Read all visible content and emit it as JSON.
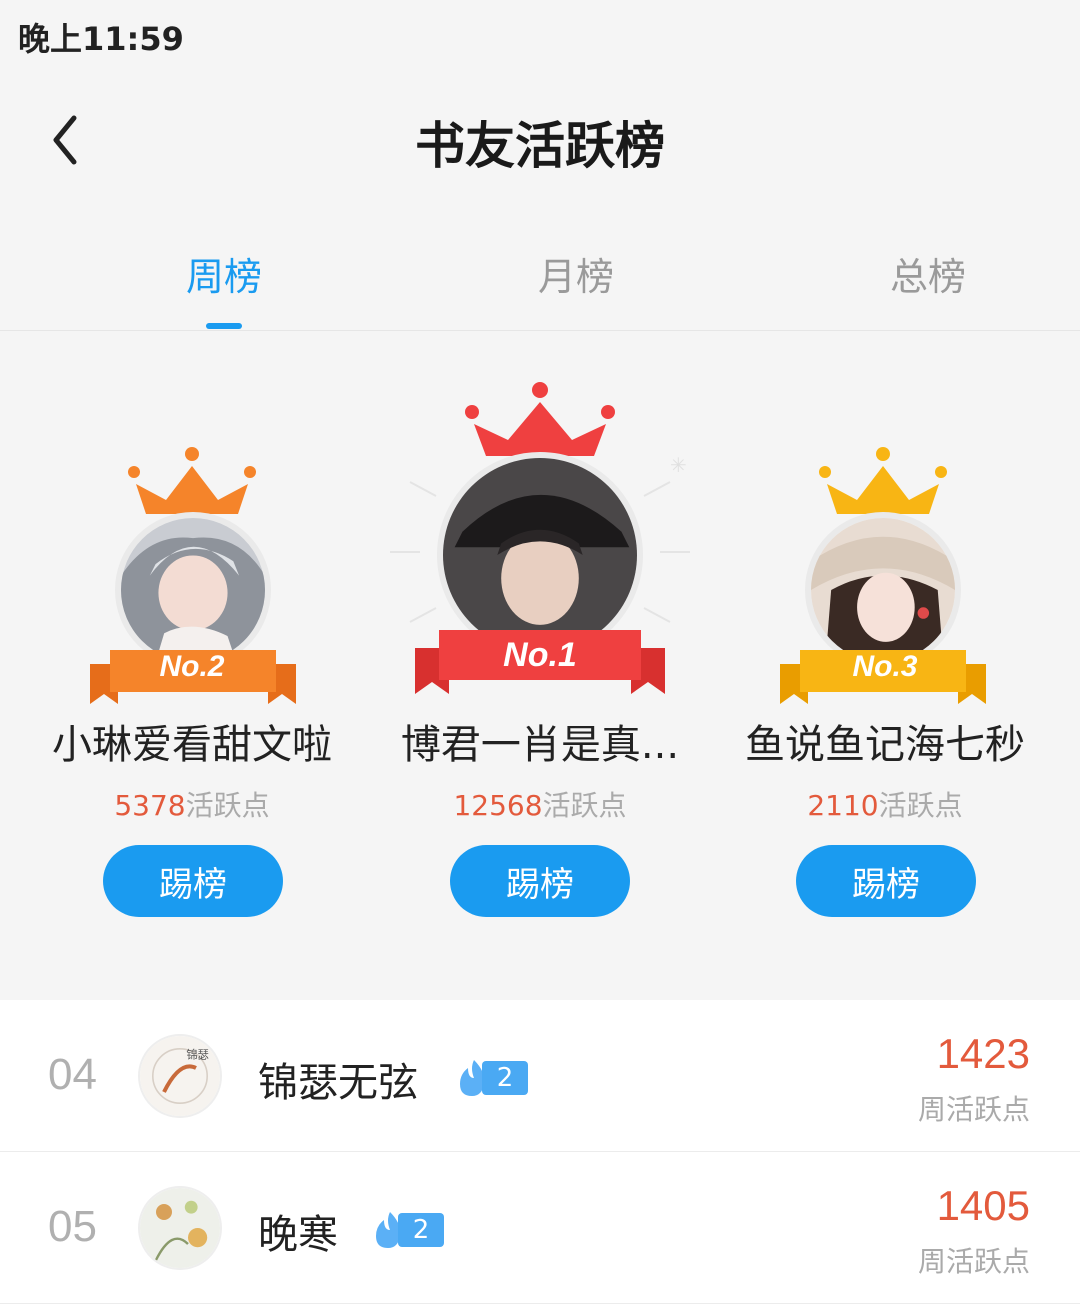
{
  "status_bar": {
    "time": "晚上11:59"
  },
  "header": {
    "title": "书友活跃榜"
  },
  "tabs": [
    {
      "label": "周榜",
      "active": true
    },
    {
      "label": "月榜",
      "active": false
    },
    {
      "label": "总榜",
      "active": false
    }
  ],
  "podium": [
    {
      "rank_label": "No.2",
      "name": "小琳爱看甜文啦",
      "points": "5378",
      "points_suffix": "活跃点",
      "button": "踢榜",
      "crown_color": "#f5842a"
    },
    {
      "rank_label": "No.1",
      "name": "博君一肖是真...",
      "points": "12568",
      "points_suffix": "活跃点",
      "button": "踢榜",
      "crown_color": "#ef4040"
    },
    {
      "rank_label": "No.3",
      "name": "鱼说鱼记海七秒",
      "points": "2110",
      "points_suffix": "活跃点",
      "button": "踢榜",
      "crown_color": "#f8b514"
    }
  ],
  "list": [
    {
      "rank": "04",
      "name": "锦瑟无弦",
      "level": "2",
      "points": "1423",
      "points_label": "周活跃点"
    },
    {
      "rank": "05",
      "name": "晚寒",
      "level": "2",
      "points": "1405",
      "points_label": "周活跃点"
    }
  ],
  "colors": {
    "accent": "#1a9bf0",
    "points": "#e35a3c",
    "gold": "#f8b514",
    "silver_orange": "#f5842a",
    "red": "#ef4040"
  }
}
